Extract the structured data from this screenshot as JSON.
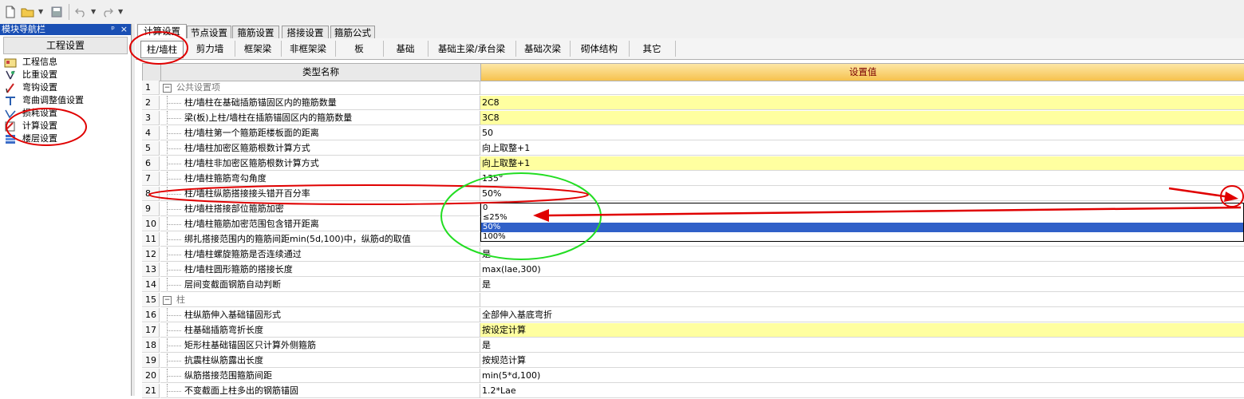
{
  "nav": {
    "title": "模块导航栏",
    "pin": "ᵖ",
    "close": "×",
    "header": "工程设置",
    "items": [
      {
        "label": "工程信息",
        "icon": "info-icon"
      },
      {
        "label": "比重设置",
        "icon": "weight-icon"
      },
      {
        "label": "弯钩设置",
        "icon": "hook-icon"
      },
      {
        "label": "弯曲调整值设置",
        "icon": "bend-icon"
      },
      {
        "label": "损耗设置",
        "icon": "loss-icon"
      },
      {
        "label": "计算设置",
        "icon": "calc-icon"
      },
      {
        "label": "楼层设置",
        "icon": "floor-icon"
      }
    ]
  },
  "tabs": [
    "计算设置",
    "节点设置",
    "箍筋设置",
    "搭接设置",
    "箍筋公式"
  ],
  "subtabs": [
    "柱/墙柱",
    "剪力墙",
    "框架梁",
    "非框架梁",
    "板",
    "基础",
    "基础主梁/承台梁",
    "基础次梁",
    "砌体结构",
    "其它"
  ],
  "grid": {
    "col_name": "类型名称",
    "col_value": "设置值"
  },
  "rows": [
    {
      "n": "1",
      "name": "公共设置项",
      "value": "",
      "group": true
    },
    {
      "n": "2",
      "name": "柱/墙柱在基础插筋锚固区内的箍筋数量",
      "value": "2C8",
      "yellow": true
    },
    {
      "n": "3",
      "name": "梁(板)上柱/墙柱在插筋锚固区内的箍筋数量",
      "value": "3C8",
      "yellow": true
    },
    {
      "n": "4",
      "name": "柱/墙柱第一个箍筋距楼板面的距离",
      "value": "50"
    },
    {
      "n": "5",
      "name": "柱/墙柱加密区箍筋根数计算方式",
      "value": "向上取整+1"
    },
    {
      "n": "6",
      "name": "柱/墙柱非加密区箍筋根数计算方式",
      "value": "向上取整+1",
      "yellow": true
    },
    {
      "n": "7",
      "name": "柱/墙柱箍筋弯勾角度",
      "value": "135°"
    },
    {
      "n": "8",
      "name": "柱/墙柱纵筋搭接接头错开百分率",
      "value": "50%"
    },
    {
      "n": "9",
      "name": "柱/墙柱搭接部位箍筋加密",
      "value": ""
    },
    {
      "n": "10",
      "name": "柱/墙柱箍筋加密范围包含错开距离",
      "value": ""
    },
    {
      "n": "11",
      "name": "绑扎搭接范围内的箍筋间距min(5d,100)中，纵筋d的取值",
      "value": ""
    },
    {
      "n": "12",
      "name": "柱/墙柱螺旋箍筋是否连续通过",
      "value": "是"
    },
    {
      "n": "13",
      "name": "柱/墙柱圆形箍筋的搭接长度",
      "value": "max(lae,300)"
    },
    {
      "n": "14",
      "name": "层间变截面钢筋自动判断",
      "value": "是"
    },
    {
      "n": "15",
      "name": "柱",
      "value": "",
      "group": true
    },
    {
      "n": "16",
      "name": "柱纵筋伸入基础锚固形式",
      "value": "全部伸入基底弯折"
    },
    {
      "n": "17",
      "name": "柱基础插筋弯折长度",
      "value": "按设定计算",
      "yellow": true
    },
    {
      "n": "18",
      "name": "矩形柱基础锚固区只计算外侧箍筋",
      "value": "是"
    },
    {
      "n": "19",
      "name": "抗震柱纵筋露出长度",
      "value": "按规范计算"
    },
    {
      "n": "20",
      "name": "纵筋搭接范围箍筋间距",
      "value": "min(5*d,100)"
    },
    {
      "n": "21",
      "name": "不变截面上柱多出的钢筋锚固",
      "value": "1.2*Lae"
    }
  ],
  "dropdown": {
    "options": [
      "0",
      "≤25%",
      "50%",
      "100%"
    ],
    "selected": "50%"
  },
  "colors": {
    "nav_title_bg": "#1a4fb4",
    "header_value_bg": "#f6c24e",
    "yellow_cell": "#ffffa0",
    "dropdown_selected": "#3060c8",
    "annotation_red": "#e00000",
    "annotation_green": "#22dd22"
  }
}
